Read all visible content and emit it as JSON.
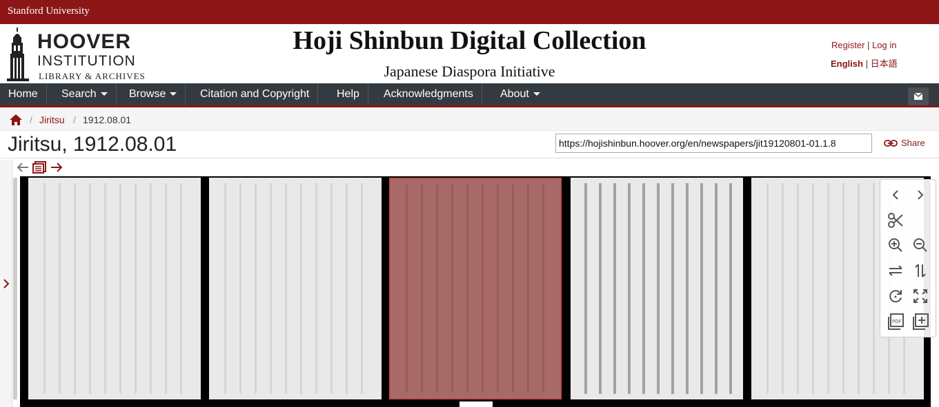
{
  "topbar": {
    "org": "Stanford University"
  },
  "banner": {
    "logo": {
      "line1": "HOOVER",
      "line2": "INSTITUTION",
      "line3": "LIBRARY & ARCHIVES"
    },
    "title": "Hoji Shinbun Digital Collection",
    "subtitle": "Japanese Diaspora Initiative",
    "account": {
      "register": "Register",
      "sep": "|",
      "login": "Log in"
    },
    "lang": {
      "en": "English",
      "sep": "|",
      "ja": "日本語"
    }
  },
  "nav": {
    "items": [
      {
        "label": "Home",
        "dropdown": false
      },
      {
        "label": "Search",
        "dropdown": true
      },
      {
        "label": "Browse",
        "dropdown": true
      },
      {
        "label": "Citation and Copyright",
        "dropdown": false
      },
      {
        "label": "Help",
        "dropdown": false
      },
      {
        "label": "Acknowledgments",
        "dropdown": false
      },
      {
        "label": "About",
        "dropdown": true
      }
    ]
  },
  "breadcrumb": {
    "sep": "/",
    "items": [
      "Jiritsu",
      "1912.08.01"
    ]
  },
  "page": {
    "title": "Jiritsu, 1912.08.01",
    "url": "https://hojishinbun.hoover.org/en/newspapers/jit19120801-01.1.8",
    "share_label": "Share"
  },
  "viewer": {
    "active_page": 3,
    "page_count_visible": 5
  },
  "colors": {
    "brand": "#8c1515",
    "navbar": "#333a40",
    "active_overlay": "#a86a68"
  },
  "icons": {
    "prev": "arrow-left-icon",
    "issue": "issue-browse-icon",
    "next": "arrow-right-icon",
    "controls": [
      "chevron-left-icon",
      "chevron-right-icon",
      "scissors-icon",
      "zoom-in-icon",
      "zoom-out-icon",
      "fit-width-icon",
      "fit-height-icon",
      "rotate-icon",
      "fullscreen-icon",
      "pdf-icon",
      "add-to-list-icon"
    ]
  }
}
